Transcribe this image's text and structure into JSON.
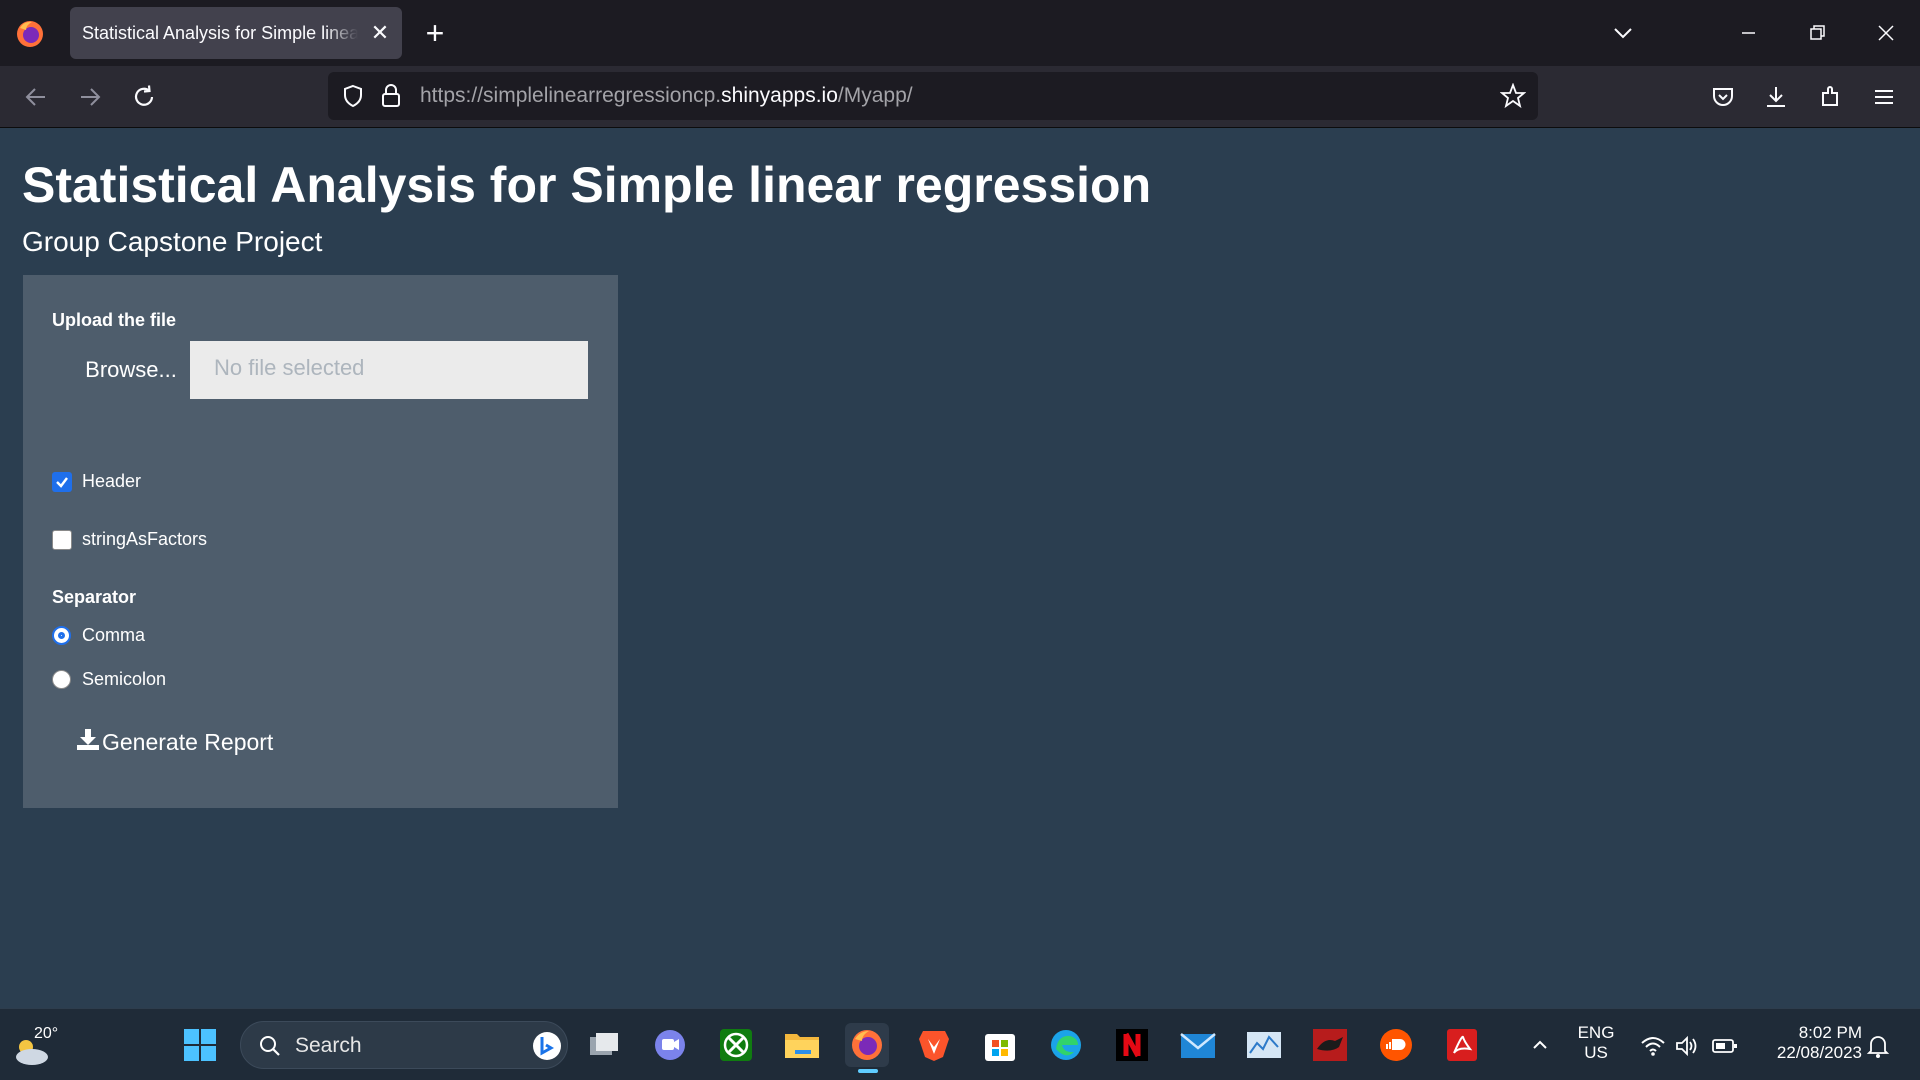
{
  "browser": {
    "tab_title": "Statistical Analysis for Simple linear",
    "url_prefix": "https://simplelinearregressioncp.",
    "url_domain": "shinyapps.io",
    "url_path": "/Myapp/"
  },
  "page": {
    "title": "Statistical Analysis for Simple linear regression",
    "subtitle": "Group Capstone Project"
  },
  "panel": {
    "upload_label": "Upload the file",
    "browse_label": "Browse...",
    "file_placeholder": "No file selected",
    "header_label": "Header",
    "header_checked": true,
    "strings_label": "stringAsFactors",
    "strings_checked": false,
    "separator_label": "Separator",
    "separator_options": [
      "Comma",
      "Semicolon"
    ],
    "separator_selected": "Comma",
    "generate_label": "Generate Report"
  },
  "taskbar": {
    "weather_temp": "20°",
    "search_label": "Search",
    "lang_line1": "ENG",
    "lang_line2": "US",
    "time": "8:02 PM",
    "date": "22/08/2023"
  },
  "colors": {
    "page_bg": "#2b3e50",
    "panel_bg": "#4e5d6c",
    "accent": "#1f6feb"
  }
}
